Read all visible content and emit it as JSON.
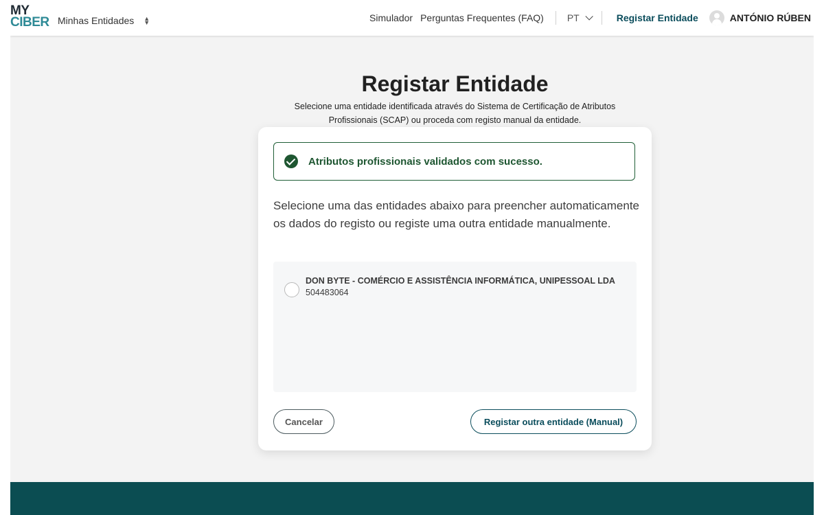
{
  "logo": {
    "line1": "MY",
    "line2": "CIBER"
  },
  "header": {
    "entities_switch": "Minhas Entidades",
    "nav": {
      "simulator": "Simulador",
      "faq": "Perguntas Frequentes (FAQ)"
    },
    "language": "PT",
    "register_link": "Registar Entidade",
    "user_name": "ANTÓNIO RÚBEN"
  },
  "main": {
    "title": "Registar Entidade",
    "subtitle": "Selecione uma entidade identificada através do Sistema de Certificação de Atributos Profissionais  (SCAP) ou proceda com registo manual da entidade."
  },
  "card": {
    "alert_message": "Atributos profissionais validados com sucesso.",
    "instructions": "Selecione uma das entidades abaixo para preencher automaticamente os dados do registo ou registe uma outra entidade manualmente.",
    "entities": [
      {
        "name": "DON BYTE - COMÉRCIO E ASSISTÊNCIA INFORMÁTICA, UNIPESSOAL LDA",
        "nif": "504483064",
        "selected": false
      }
    ],
    "cancel_button": "Cancelar",
    "manual_button": "Registar outra entidade (Manual)"
  },
  "colors": {
    "brand_dark": "#0b4d52",
    "success": "#1e5631",
    "logo_accent": "#2e8a96"
  }
}
